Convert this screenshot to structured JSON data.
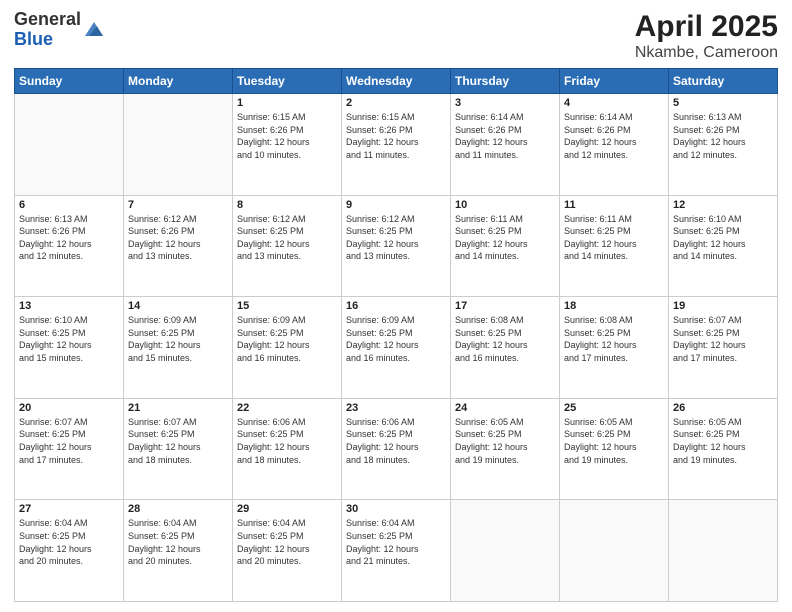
{
  "header": {
    "logo_general": "General",
    "logo_blue": "Blue",
    "title": "April 2025",
    "subtitle": "Nkambe, Cameroon"
  },
  "calendar": {
    "days_of_week": [
      "Sunday",
      "Monday",
      "Tuesday",
      "Wednesday",
      "Thursday",
      "Friday",
      "Saturday"
    ],
    "weeks": [
      [
        {
          "day": "",
          "info": ""
        },
        {
          "day": "",
          "info": ""
        },
        {
          "day": "1",
          "info": "Sunrise: 6:15 AM\nSunset: 6:26 PM\nDaylight: 12 hours\nand 10 minutes."
        },
        {
          "day": "2",
          "info": "Sunrise: 6:15 AM\nSunset: 6:26 PM\nDaylight: 12 hours\nand 11 minutes."
        },
        {
          "day": "3",
          "info": "Sunrise: 6:14 AM\nSunset: 6:26 PM\nDaylight: 12 hours\nand 11 minutes."
        },
        {
          "day": "4",
          "info": "Sunrise: 6:14 AM\nSunset: 6:26 PM\nDaylight: 12 hours\nand 12 minutes."
        },
        {
          "day": "5",
          "info": "Sunrise: 6:13 AM\nSunset: 6:26 PM\nDaylight: 12 hours\nand 12 minutes."
        }
      ],
      [
        {
          "day": "6",
          "info": "Sunrise: 6:13 AM\nSunset: 6:26 PM\nDaylight: 12 hours\nand 12 minutes."
        },
        {
          "day": "7",
          "info": "Sunrise: 6:12 AM\nSunset: 6:26 PM\nDaylight: 12 hours\nand 13 minutes."
        },
        {
          "day": "8",
          "info": "Sunrise: 6:12 AM\nSunset: 6:25 PM\nDaylight: 12 hours\nand 13 minutes."
        },
        {
          "day": "9",
          "info": "Sunrise: 6:12 AM\nSunset: 6:25 PM\nDaylight: 12 hours\nand 13 minutes."
        },
        {
          "day": "10",
          "info": "Sunrise: 6:11 AM\nSunset: 6:25 PM\nDaylight: 12 hours\nand 14 minutes."
        },
        {
          "day": "11",
          "info": "Sunrise: 6:11 AM\nSunset: 6:25 PM\nDaylight: 12 hours\nand 14 minutes."
        },
        {
          "day": "12",
          "info": "Sunrise: 6:10 AM\nSunset: 6:25 PM\nDaylight: 12 hours\nand 14 minutes."
        }
      ],
      [
        {
          "day": "13",
          "info": "Sunrise: 6:10 AM\nSunset: 6:25 PM\nDaylight: 12 hours\nand 15 minutes."
        },
        {
          "day": "14",
          "info": "Sunrise: 6:09 AM\nSunset: 6:25 PM\nDaylight: 12 hours\nand 15 minutes."
        },
        {
          "day": "15",
          "info": "Sunrise: 6:09 AM\nSunset: 6:25 PM\nDaylight: 12 hours\nand 16 minutes."
        },
        {
          "day": "16",
          "info": "Sunrise: 6:09 AM\nSunset: 6:25 PM\nDaylight: 12 hours\nand 16 minutes."
        },
        {
          "day": "17",
          "info": "Sunrise: 6:08 AM\nSunset: 6:25 PM\nDaylight: 12 hours\nand 16 minutes."
        },
        {
          "day": "18",
          "info": "Sunrise: 6:08 AM\nSunset: 6:25 PM\nDaylight: 12 hours\nand 17 minutes."
        },
        {
          "day": "19",
          "info": "Sunrise: 6:07 AM\nSunset: 6:25 PM\nDaylight: 12 hours\nand 17 minutes."
        }
      ],
      [
        {
          "day": "20",
          "info": "Sunrise: 6:07 AM\nSunset: 6:25 PM\nDaylight: 12 hours\nand 17 minutes."
        },
        {
          "day": "21",
          "info": "Sunrise: 6:07 AM\nSunset: 6:25 PM\nDaylight: 12 hours\nand 18 minutes."
        },
        {
          "day": "22",
          "info": "Sunrise: 6:06 AM\nSunset: 6:25 PM\nDaylight: 12 hours\nand 18 minutes."
        },
        {
          "day": "23",
          "info": "Sunrise: 6:06 AM\nSunset: 6:25 PM\nDaylight: 12 hours\nand 18 minutes."
        },
        {
          "day": "24",
          "info": "Sunrise: 6:05 AM\nSunset: 6:25 PM\nDaylight: 12 hours\nand 19 minutes."
        },
        {
          "day": "25",
          "info": "Sunrise: 6:05 AM\nSunset: 6:25 PM\nDaylight: 12 hours\nand 19 minutes."
        },
        {
          "day": "26",
          "info": "Sunrise: 6:05 AM\nSunset: 6:25 PM\nDaylight: 12 hours\nand 19 minutes."
        }
      ],
      [
        {
          "day": "27",
          "info": "Sunrise: 6:04 AM\nSunset: 6:25 PM\nDaylight: 12 hours\nand 20 minutes."
        },
        {
          "day": "28",
          "info": "Sunrise: 6:04 AM\nSunset: 6:25 PM\nDaylight: 12 hours\nand 20 minutes."
        },
        {
          "day": "29",
          "info": "Sunrise: 6:04 AM\nSunset: 6:25 PM\nDaylight: 12 hours\nand 20 minutes."
        },
        {
          "day": "30",
          "info": "Sunrise: 6:04 AM\nSunset: 6:25 PM\nDaylight: 12 hours\nand 21 minutes."
        },
        {
          "day": "",
          "info": ""
        },
        {
          "day": "",
          "info": ""
        },
        {
          "day": "",
          "info": ""
        }
      ]
    ]
  }
}
